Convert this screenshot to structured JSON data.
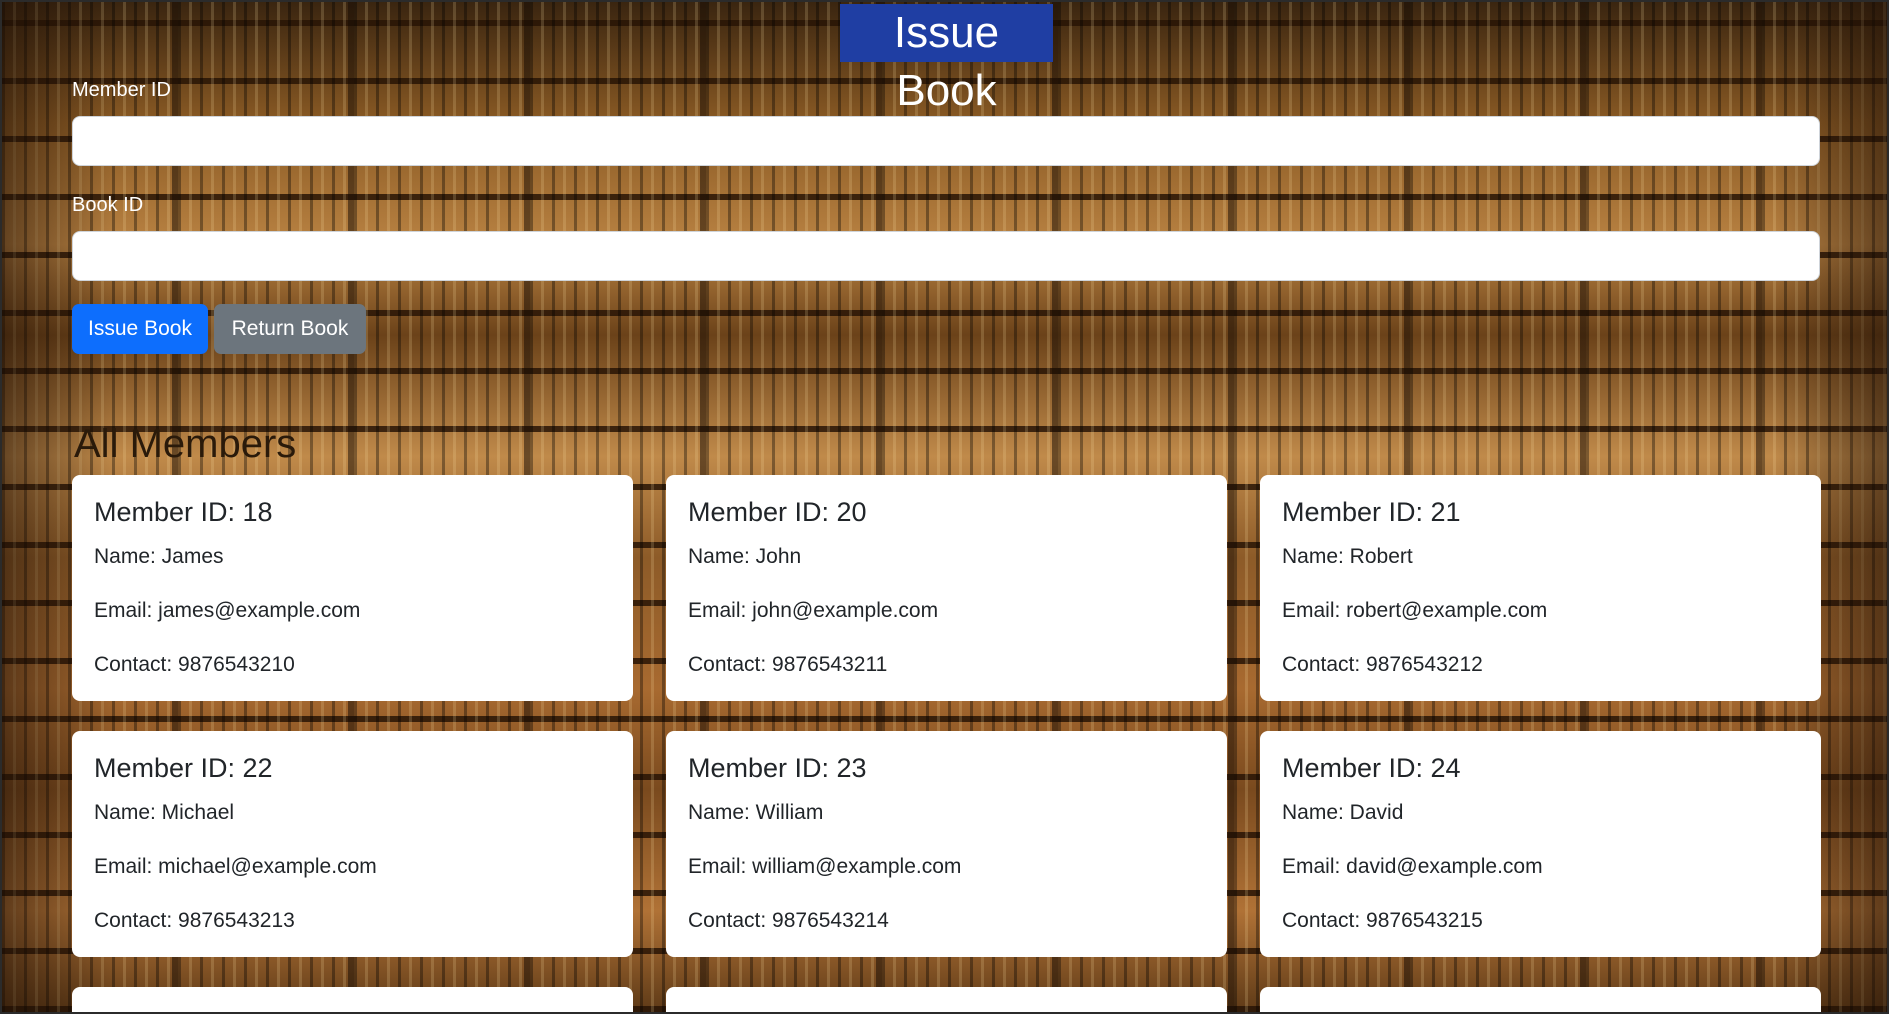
{
  "header": {
    "title": "Issue Book"
  },
  "form": {
    "member_label": "Member ID",
    "member_value": "",
    "book_label": "Book ID",
    "book_value": "",
    "issue_button": "Issue Book",
    "return_button": "Return Book"
  },
  "members_section": {
    "title": "All Members"
  },
  "members": [
    {
      "id_label": "Member ID: 18",
      "name": "Name: James",
      "email": "Email: james@example.com",
      "contact": "Contact: 9876543210"
    },
    {
      "id_label": "Member ID: 20",
      "name": "Name: John",
      "email": "Email: john@example.com",
      "contact": "Contact: 9876543211"
    },
    {
      "id_label": "Member ID: 21",
      "name": "Name: Robert",
      "email": "Email: robert@example.com",
      "contact": "Contact: 9876543212"
    },
    {
      "id_label": "Member ID: 22",
      "name": "Name: Michael",
      "email": "Email: michael@example.com",
      "contact": "Contact: 9876543213"
    },
    {
      "id_label": "Member ID: 23",
      "name": "Name: William",
      "email": "Email: william@example.com",
      "contact": "Contact: 9876543214"
    },
    {
      "id_label": "Member ID: 24",
      "name": "Name: David",
      "email": "Email: david@example.com",
      "contact": "Contact: 9876543215"
    }
  ],
  "colors": {
    "title_bg": "#1f3ea3",
    "primary_button": "#0d6efd",
    "secondary_button": "#6c757d",
    "card_bg": "#ffffff"
  }
}
